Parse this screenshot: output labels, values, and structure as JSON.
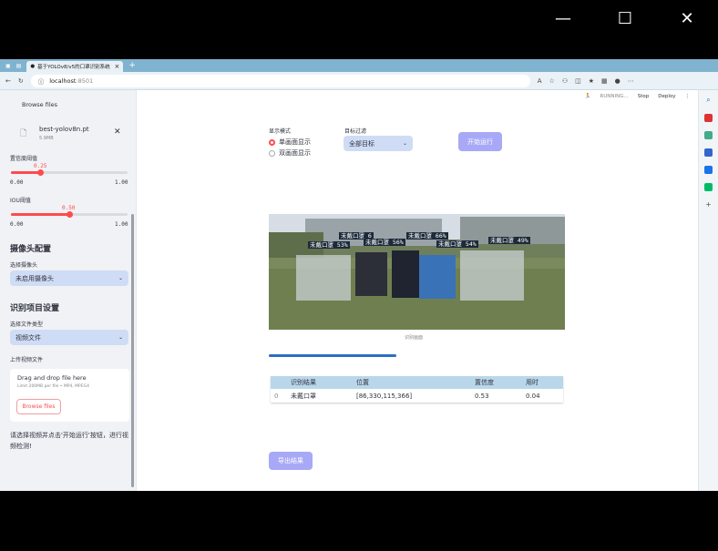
{
  "window": {
    "controls": [
      "—",
      "☐",
      "✕"
    ]
  },
  "browser": {
    "tab_title": "基于YOLOv8/v5的口罩识别系统",
    "url_prefix": "localhost",
    "url_port": ":8501"
  },
  "sidebar": {
    "browse_files_top": "Browse files",
    "file_name": "best-yolov8n.pt",
    "file_size": "5.9MB",
    "conf_label": "置信度阈值",
    "conf_value": "0.25",
    "conf_min": "0.00",
    "conf_max": "1.00",
    "conf_fraction": 0.25,
    "iou_label": "IOU阈值",
    "iou_value": "0.50",
    "iou_min": "0.00",
    "iou_max": "1.00",
    "iou_fraction": 0.5,
    "camera_header": "摄像头配置",
    "camera_select_label": "选择摄像头",
    "camera_select_value": "未启用摄像头",
    "project_header": "识别项目设置",
    "filetype_label": "选择文件类型",
    "filetype_value": "视频文件",
    "upload_label": "上传视频文件",
    "drop_text": "Drag and drop file here",
    "drop_limit": "Limit 200MB per file • MP4, MPEG4",
    "browse_button": "Browse files",
    "hint": "请选择视频并点击'开始运行'按钮，进行视频检测!"
  },
  "toolbar": {
    "status": "RUNNING...",
    "stop": "Stop",
    "deploy": "Deploy"
  },
  "main": {
    "display_mode_label": "显示模式",
    "mode_single": "单画面显示",
    "mode_double": "双画面显示",
    "target_filter_label": "目标过滤",
    "target_filter_value": "全部目标",
    "run_button": "开始运行",
    "image_caption": "识别画面",
    "progress": 0.43,
    "export_button": "导出结果",
    "detections": [
      {
        "label": "未戴口罩 6"
      },
      {
        "label": "未戴口罩 66%"
      },
      {
        "label": "未戴口罩 56%"
      },
      {
        "label": "未戴口罩 49%"
      },
      {
        "label": "未戴口罩 53%"
      },
      {
        "label": "未戴口罩 54%"
      }
    ],
    "table": {
      "headers": [
        "",
        "识别结果",
        "位置",
        "置信度",
        "用时"
      ],
      "rows": [
        {
          "index": "0",
          "result": "未戴口罩",
          "position": "[86,330,115,366]",
          "confidence": "0.53",
          "time": "0.04"
        }
      ]
    }
  },
  "colors": {
    "accent": "#ff4b4b",
    "button": "#a8a9f6",
    "table_header": "#b9d7ea",
    "select_bg": "#cfdcf5"
  }
}
